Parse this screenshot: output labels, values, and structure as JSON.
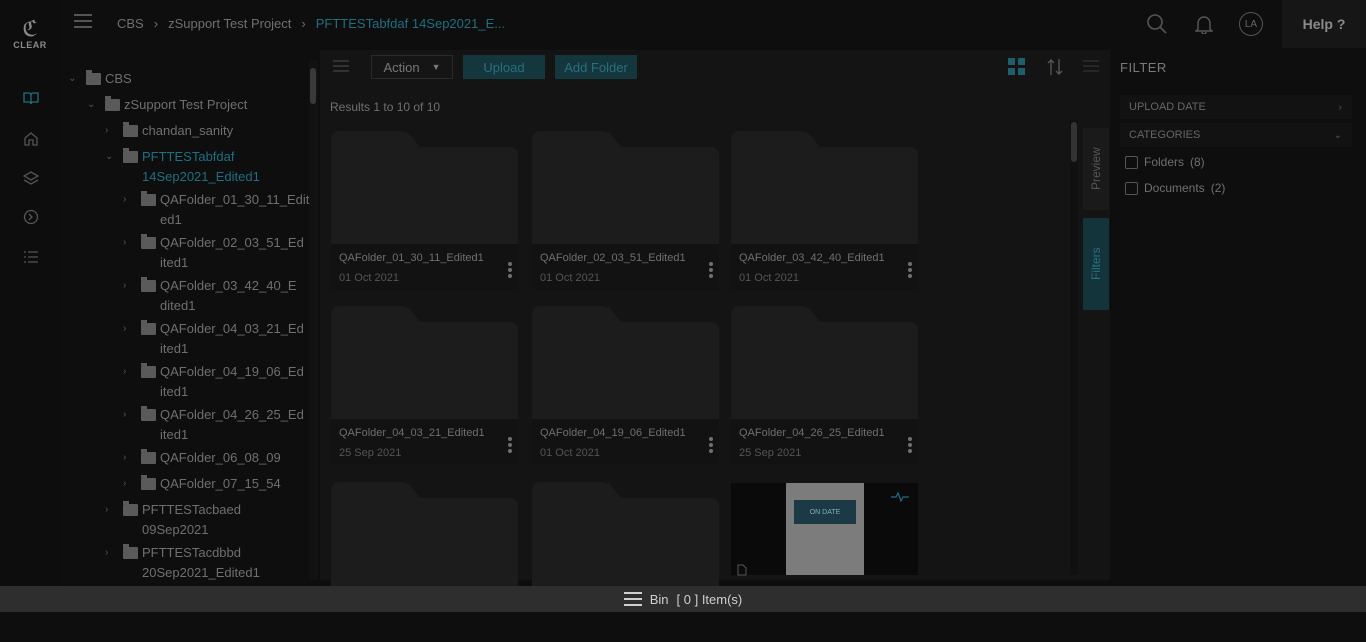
{
  "logo": {
    "text": "CLEAR"
  },
  "breadcrumb": [
    "CBS",
    "zSupport Test Project",
    "PFTTESTabfdaf 14Sep2021_E..."
  ],
  "header": {
    "help_label": "Help ?",
    "avatar_initials": "LA"
  },
  "tree": {
    "root": "CBS",
    "project": "zSupport Test Project",
    "nodes": [
      {
        "label": "chandan_sanity",
        "indent": 2
      },
      {
        "label": "PFTTESTabfdaf",
        "label2": "14Sep2021_Edited1",
        "indent": 2,
        "active": true
      },
      {
        "label": "QAFolder_01_30_11_Edit",
        "label2": "ed1",
        "indent": 3
      },
      {
        "label": "QAFolder_02_03_51_Ed",
        "label2": "ited1",
        "indent": 3
      },
      {
        "label": "QAFolder_03_42_40_E",
        "label2": "dited1",
        "indent": 3
      },
      {
        "label": "QAFolder_04_03_21_Ed",
        "label2": "ited1",
        "indent": 3
      },
      {
        "label": "QAFolder_04_19_06_Ed",
        "label2": "ited1",
        "indent": 3
      },
      {
        "label": "QAFolder_04_26_25_Ed",
        "label2": "ited1",
        "indent": 3
      },
      {
        "label": "QAFolder_06_08_09",
        "indent": 3
      },
      {
        "label": "QAFolder_07_15_54",
        "indent": 3
      },
      {
        "label": "PFTTESTacbaed",
        "label2": "09Sep2021",
        "indent": 2
      },
      {
        "label": "PFTTESTacdbbd",
        "label2": "20Sep2021_Edited1",
        "indent": 2
      }
    ]
  },
  "toolbar": {
    "action_label": "Action",
    "upload_label": "Upload",
    "add_folder_label": "Add Folder"
  },
  "results_text": "Results 1 to 10 of 10",
  "cards": [
    {
      "name": "QAFolder_01_30_11_Edited1",
      "date": "01 Oct 2021"
    },
    {
      "name": "QAFolder_02_03_51_Edited1",
      "date": "01 Oct 2021"
    },
    {
      "name": "QAFolder_03_42_40_Edited1",
      "date": "01 Oct 2021"
    },
    {
      "name": "QAFolder_04_03_21_Edited1",
      "date": "25 Sep 2021"
    },
    {
      "name": "QAFolder_04_19_06_Edited1",
      "date": "01 Oct 2021"
    },
    {
      "name": "QAFolder_04_26_25_Edited1",
      "date": "25 Sep 2021"
    }
  ],
  "doc_thumb_text": "ON DATE",
  "side_tabs": {
    "preview": "Preview",
    "filters": "Filters"
  },
  "filter": {
    "title": "FILTER",
    "upload_date": "UPLOAD DATE",
    "categories": "CATEGORIES",
    "options": [
      {
        "label": "Folders",
        "count": "(8)"
      },
      {
        "label": "Documents",
        "count": "(2)"
      }
    ]
  },
  "bin": {
    "label": "Bin",
    "count_text": "[ 0 ] Item(s)"
  }
}
